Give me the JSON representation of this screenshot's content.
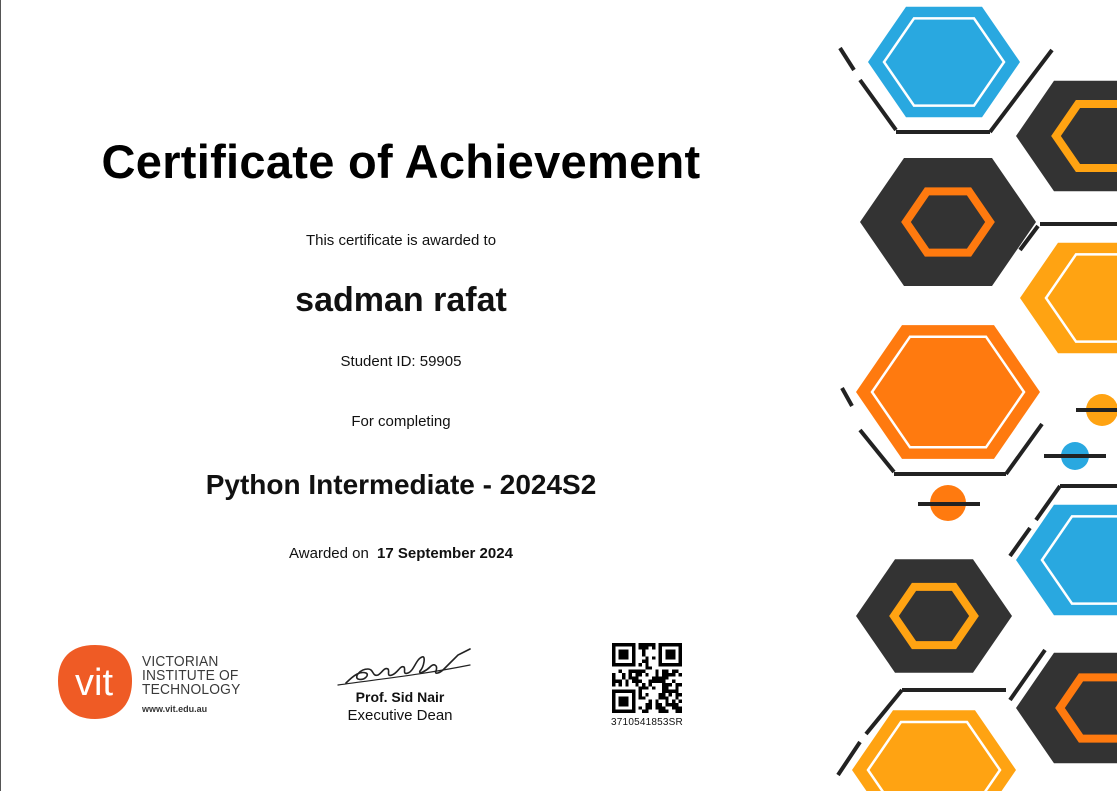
{
  "certificate": {
    "title": "Certificate of Achievement",
    "awarded_to_text": "This certificate is awarded to",
    "recipient_name": "sadman rafat",
    "student_id_text": "Student ID: 59905",
    "for_completing_text": "For completing",
    "course_name": "Python Intermediate - 2024S2",
    "awarded_on_label": "Awarded on",
    "awarded_on_date": "17 September 2024"
  },
  "institution": {
    "name_line1": "VICTORIAN",
    "name_line2": "INSTITUTE OF",
    "name_line3": "TECHNOLOGY",
    "url": "www.vit.edu.au",
    "logo_text": "vit",
    "logo_color": "#ef5b25"
  },
  "signatory": {
    "name": "Prof. Sid Nair",
    "role": "Executive Dean"
  },
  "verification": {
    "code": "3710541853SR"
  },
  "colors": {
    "blue": "#29a8e0",
    "orange": "#ff7a0f",
    "amber": "#ffa312",
    "dark": "#333333"
  }
}
